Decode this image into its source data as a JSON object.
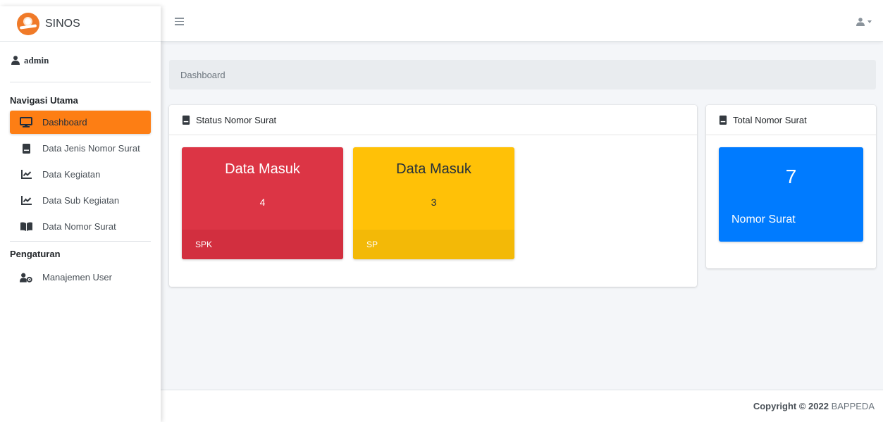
{
  "brand": {
    "name": "SINOS"
  },
  "user": {
    "name": "admin"
  },
  "sidebar": {
    "main_header": "Navigasi Utama",
    "items": [
      {
        "label": "Dashboard",
        "icon": "monitor-icon",
        "active": true
      },
      {
        "label": "Data Jenis Nomor Surat",
        "icon": "book-icon"
      },
      {
        "label": "Data Kegiatan",
        "icon": "chart-line-icon"
      },
      {
        "label": "Data Sub Kegiatan",
        "icon": "chart-line-icon"
      },
      {
        "label": "Data Nomor Surat",
        "icon": "open-book-icon"
      }
    ],
    "settings_header": "Pengaturan",
    "settings_items": [
      {
        "label": "Manajemen User",
        "icon": "user-cog-icon"
      }
    ]
  },
  "breadcrumb": {
    "current": "Dashboard"
  },
  "status_card": {
    "title": "Status Nomor Surat",
    "boxes": [
      {
        "title": "Data Masuk",
        "count": "4",
        "footer": "SPK",
        "color": "#dc3545"
      },
      {
        "title": "Data Masuk",
        "count": "3",
        "footer": "SP",
        "color": "#ffc107"
      }
    ]
  },
  "total_card": {
    "title": "Total Nomor Surat",
    "value": "7",
    "label": "Nomor Surat",
    "color": "#007bff"
  },
  "footer": {
    "copyright_label": "Copyright © 2022",
    "org": "BAPPEDA"
  },
  "colors": {
    "accent": "#fd7e14",
    "danger": "#dc3545",
    "warning": "#ffc107",
    "primary": "#007bff"
  }
}
